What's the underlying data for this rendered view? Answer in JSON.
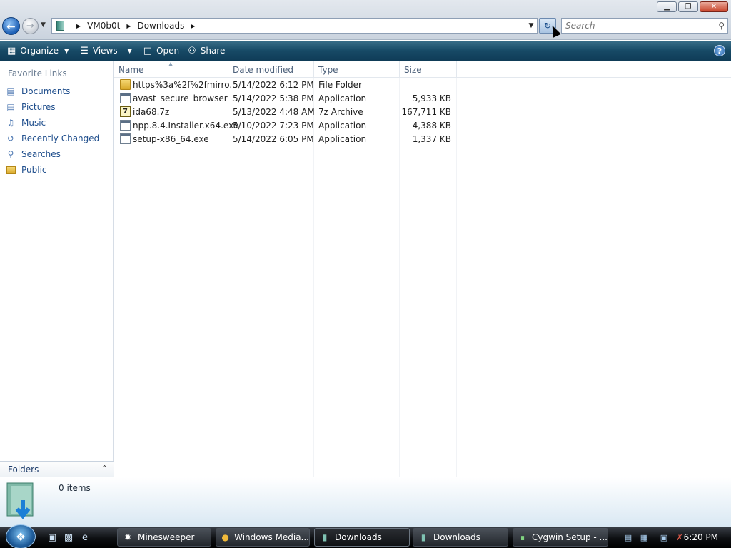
{
  "window": {
    "minimize_glyph": "▁",
    "maximize_glyph": "❐",
    "close_glyph": "✕"
  },
  "address": {
    "crumbs": [
      "VM0b0t",
      "Downloads"
    ]
  },
  "search": {
    "placeholder": "Search"
  },
  "toolbar": {
    "organize_label": "Organize",
    "views_label": "Views",
    "open_label": "Open",
    "share_label": "Share"
  },
  "sidebar": {
    "title": "Favorite Links",
    "items": [
      {
        "label": "Documents",
        "icon": "documents-icon"
      },
      {
        "label": "Pictures",
        "icon": "pictures-icon"
      },
      {
        "label": "Music",
        "icon": "music-icon"
      },
      {
        "label": "Recently Changed",
        "icon": "recently-changed-icon"
      },
      {
        "label": "Searches",
        "icon": "searches-icon"
      },
      {
        "label": "Public",
        "icon": "public-folder-icon"
      }
    ],
    "folders_label": "Folders"
  },
  "columns": {
    "name": "Name",
    "date": "Date modified",
    "type": "Type",
    "size": "Size"
  },
  "files": [
    {
      "name": "https%3a%2f%2fmirro...",
      "date": "5/14/2022 6:12 PM",
      "type": "File Folder",
      "size": "",
      "icon": "folder-icon"
    },
    {
      "name": "avast_secure_browser_...",
      "date": "5/14/2022 5:38 PM",
      "type": "Application",
      "size": "5,933 KB",
      "icon": "application-icon"
    },
    {
      "name": "ida68.7z",
      "date": "5/13/2022 4:48 AM",
      "type": "7z Archive",
      "size": "167,711 KB",
      "icon": "archive-icon"
    },
    {
      "name": "npp.8.4.Installer.x64.exe",
      "date": "5/10/2022 7:23 PM",
      "type": "Application",
      "size": "4,388 KB",
      "icon": "application-icon"
    },
    {
      "name": "setup-x86_64.exe",
      "date": "5/14/2022 6:05 PM",
      "type": "Application",
      "size": "1,337 KB",
      "icon": "application-icon"
    }
  ],
  "details": {
    "items_count": "0 items"
  },
  "taskbar": {
    "tasks": [
      {
        "label": "Minesweeper",
        "icon": "minesweeper-icon"
      },
      {
        "label": "Windows Media...",
        "icon": "media-player-icon"
      },
      {
        "label": "Downloads",
        "icon": "explorer-icon"
      },
      {
        "label": "Downloads",
        "icon": "explorer-icon"
      },
      {
        "label": "Cygwin Setup - ...",
        "icon": "cygwin-icon"
      }
    ],
    "clock": "6:20 PM"
  },
  "colors": {
    "toolbar": "#174a66",
    "link": "#1f4e8c",
    "taskbar": "#0d0f12"
  }
}
